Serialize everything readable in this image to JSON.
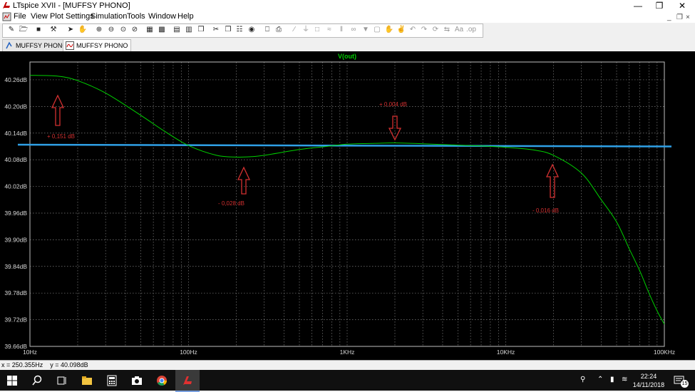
{
  "window": {
    "title": "LTspice XVII - [MUFFSY PHONO]"
  },
  "menu": {
    "items": [
      "File",
      "View",
      "Plot Settings",
      "Simulation",
      "Tools",
      "Window",
      "Help"
    ]
  },
  "toolbar": {
    "buttons": [
      "new-schematic-icon",
      "open-icon",
      "save-icon",
      "control-panel-icon",
      "run-icon",
      "halt-icon",
      "zoom-in-icon",
      "zoom-out-icon",
      "zoom-fit-icon",
      "zoom-cancel-icon",
      "autorange-icon",
      "grid-icon",
      "tile-horizontal-icon",
      "tile-vertical-icon",
      "cascade-icon",
      "cut-icon",
      "copy-icon",
      "paste-icon",
      "find-icon",
      "print-setup-icon",
      "print-icon",
      "wire-icon",
      "ground-icon",
      "label-icon",
      "resistor-icon",
      "capacitor-icon",
      "inductor-icon",
      "diode-icon",
      "component-icon",
      "move-icon",
      "drag-icon",
      "undo-icon",
      "redo-icon",
      "rotate-icon",
      "mirror-icon",
      "text-icon",
      "spice-directive-icon"
    ]
  },
  "tabs": [
    {
      "label": "MUFFSY PHONO",
      "icon": "schematic-icon",
      "active": false
    },
    {
      "label": "MUFFSY PHONO",
      "icon": "waveform-icon",
      "active": true
    }
  ],
  "plot": {
    "trace_label": "V(out)",
    "trace_color": "#00d000",
    "ref_line_color": "#2fa0e6",
    "annotation_color": "#d33030",
    "y_ticks": [
      "40.26dB",
      "40.20dB",
      "40.14dB",
      "40.08dB",
      "40.02dB",
      "39.96dB",
      "39.90dB",
      "39.84dB",
      "39.78dB",
      "39.72dB",
      "39.66dB"
    ],
    "x_ticks": [
      "10Hz",
      "100Hz",
      "1KHz",
      "10KHz",
      "100KHz"
    ],
    "annotations": [
      {
        "label": "+ 0,151 dB",
        "dir": "up"
      },
      {
        "label": "- 0,028 dB",
        "dir": "up"
      },
      {
        "label": "+ 0,004 dB",
        "dir": "down"
      },
      {
        "label": "- 0,016 dB",
        "dir": "up"
      }
    ]
  },
  "chart_data": {
    "type": "line",
    "title": "V(out)",
    "xlabel": "",
    "ylabel": "",
    "x_scale": "log",
    "xlim": [
      "10Hz",
      "100KHz"
    ],
    "ylim": [
      39.66,
      40.3
    ],
    "grid": true,
    "series": [
      {
        "name": "V(out)",
        "color": "#00d000",
        "x": [
          10,
          15,
          20,
          30,
          50,
          70,
          100,
          150,
          200,
          250,
          300,
          500,
          700,
          1000,
          1500,
          2000,
          3000,
          5000,
          7000,
          10000,
          15000,
          20000,
          30000,
          40000,
          50000,
          60000,
          70000,
          80000,
          90000,
          100000
        ],
        "y": [
          40.27,
          40.268,
          40.258,
          40.23,
          40.18,
          40.145,
          40.112,
          40.09,
          40.086,
          40.087,
          40.09,
          40.103,
          40.109,
          40.115,
          40.117,
          40.118,
          40.116,
          40.113,
          40.111,
          40.108,
          40.102,
          40.09,
          40.05,
          39.99,
          39.94,
          39.88,
          39.83,
          39.78,
          39.74,
          39.71
        ]
      },
      {
        "x": [
          10,
          100000
        ],
        "y": [
          40.114,
          40.11
        ]
      }
    ]
  },
  "status": {
    "coords": "x = 250.355Hz    y = 40.098dB"
  },
  "taskbar": {
    "apps": [
      "start-icon",
      "search-icon",
      "task-view-icon",
      "explorer-icon",
      "calculator-icon",
      "camera-icon",
      "chrome-icon",
      "ltspice-icon"
    ],
    "time": "22:24",
    "date": "14/11/2018",
    "notifications": "15"
  }
}
